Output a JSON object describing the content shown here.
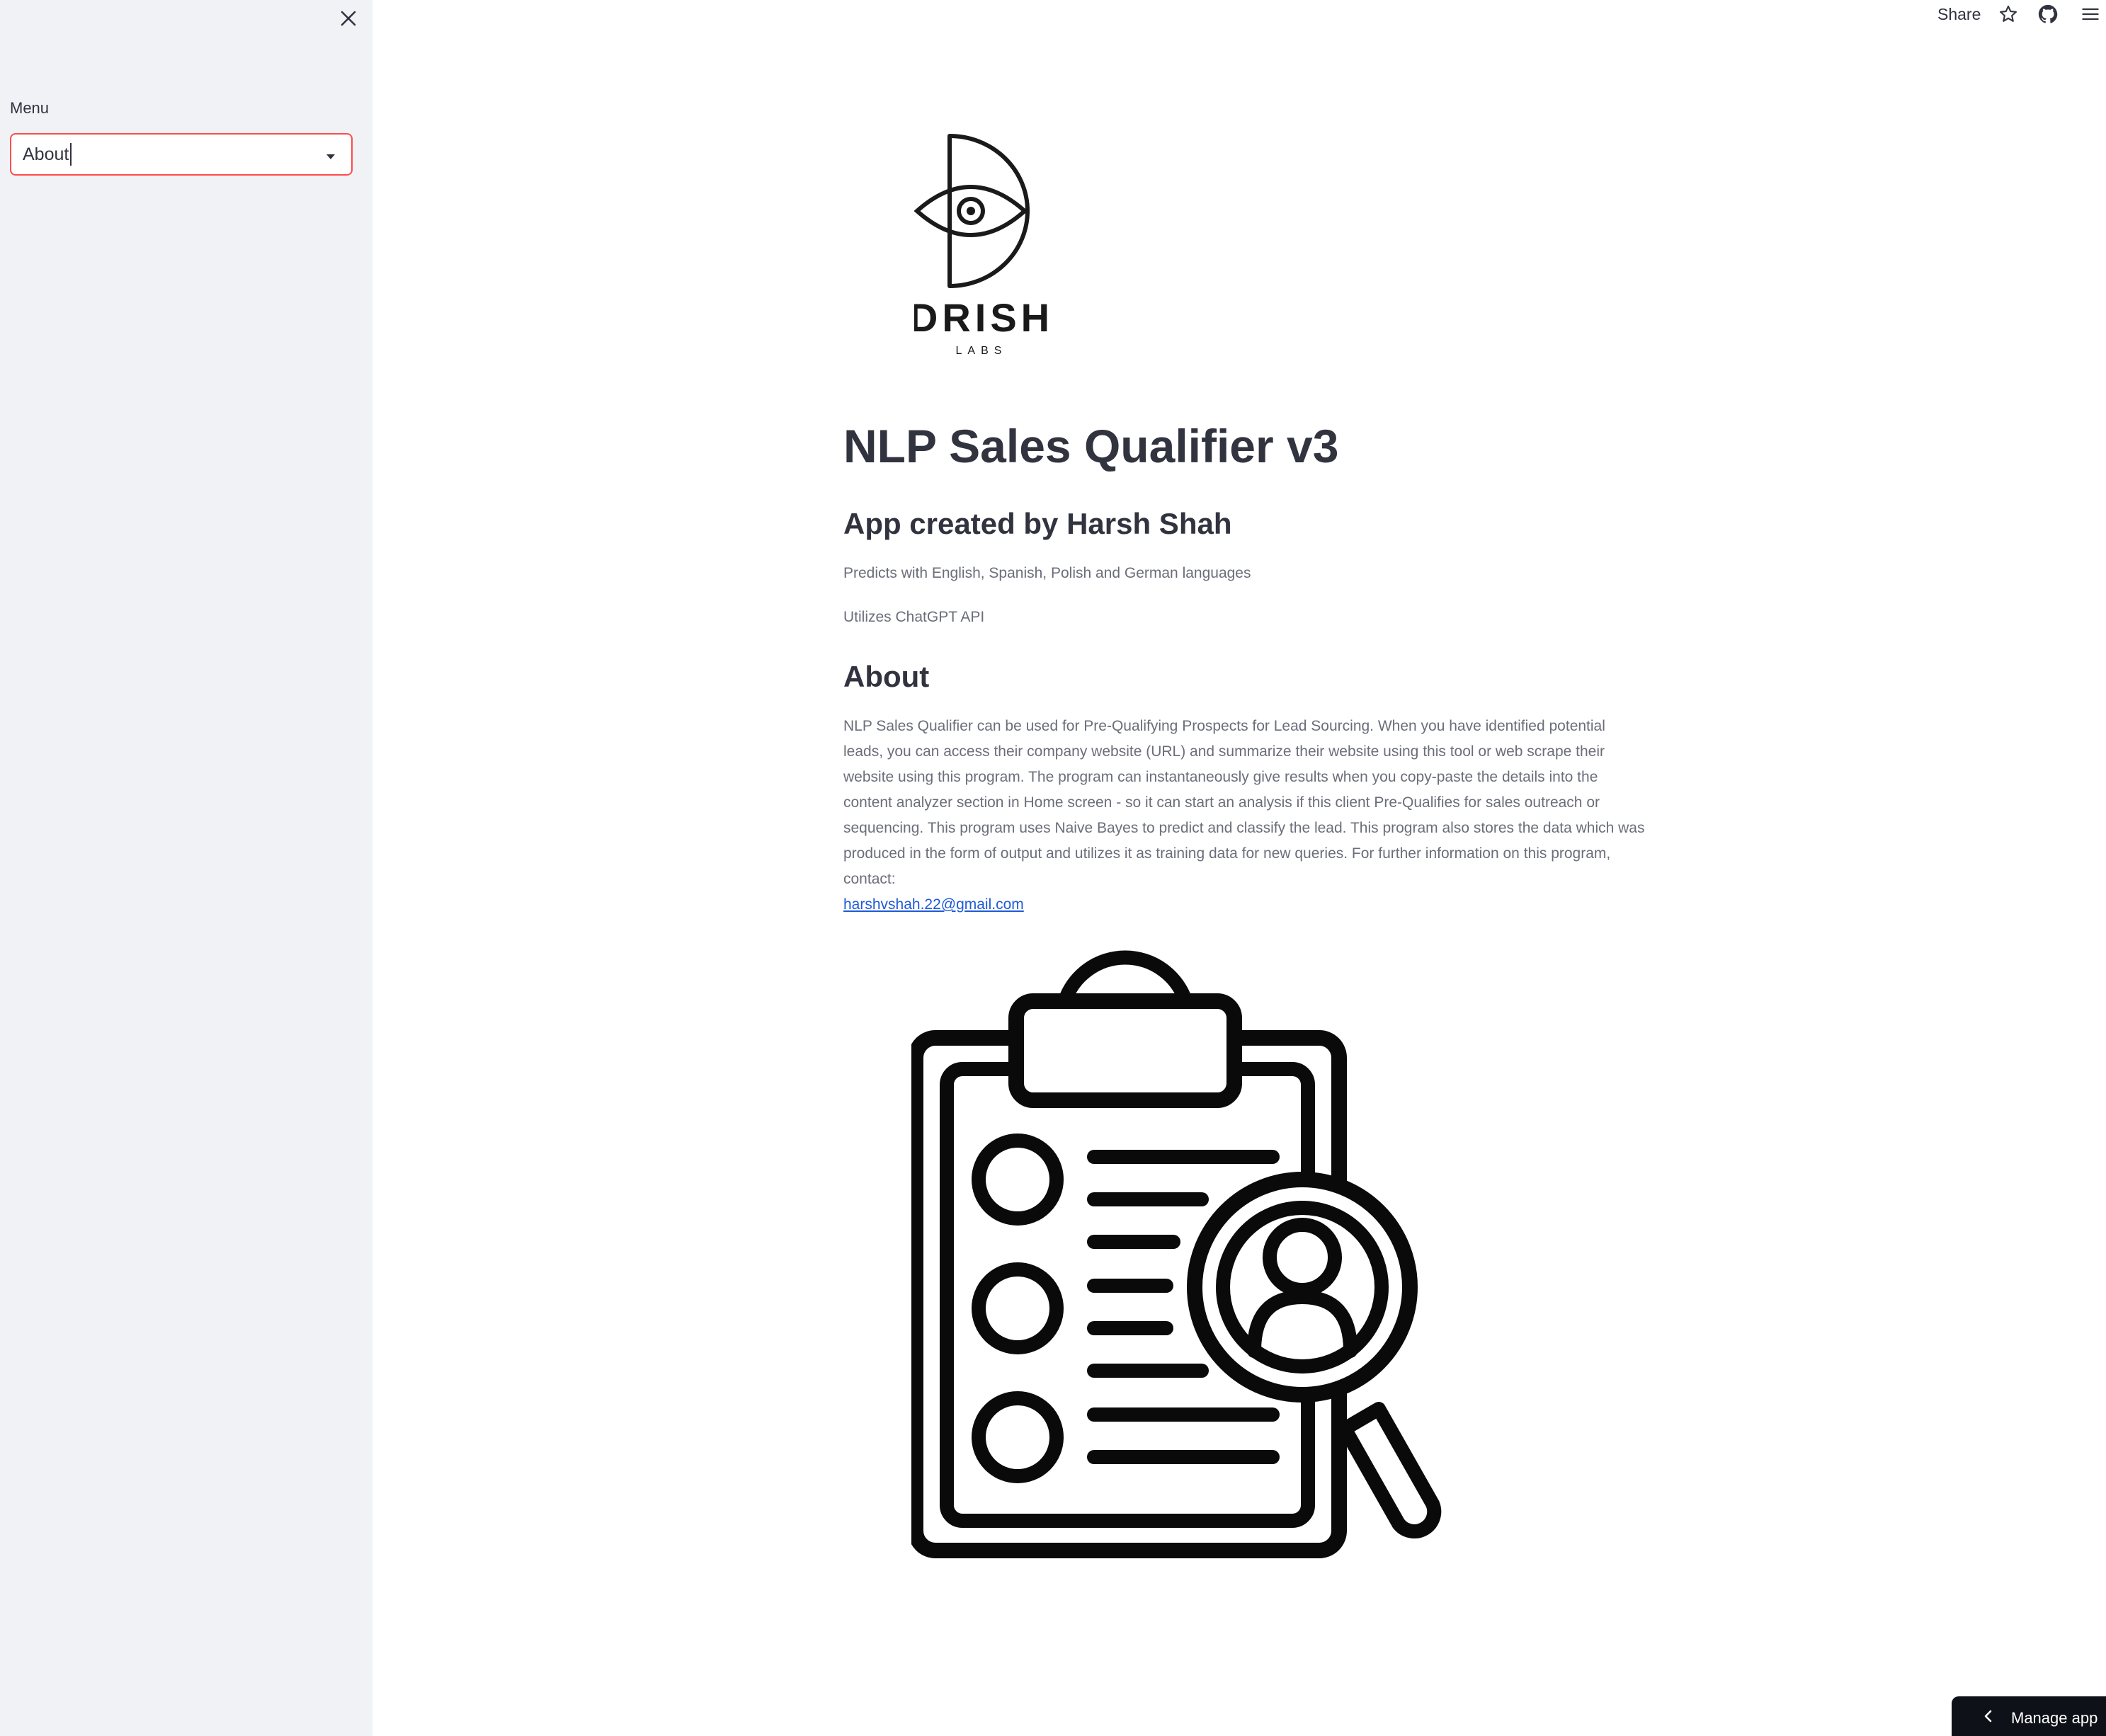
{
  "sidebar": {
    "menu_label": "Menu",
    "menu_selected": "About",
    "close_icon": "close-icon"
  },
  "toolbar": {
    "share_label": "Share",
    "icons": [
      "star-icon",
      "github-icon",
      "hamburger-menu-icon"
    ]
  },
  "main": {
    "logo": {
      "wordmark": "DRISH",
      "subtext": "LABS"
    },
    "title": "NLP Sales Qualifier v3",
    "subtitle": "App created by Harsh Shah",
    "captions": [
      "Predicts with English, Spanish, Polish and German languages",
      "Utilizes ChatGPT API"
    ],
    "about_heading": "About",
    "about_text": "NLP Sales Qualifier can be used for Pre-Qualifying Prospects for Lead Sourcing. When you have identified potential leads, you can access their company website (URL) and summarize their website using this tool or web scrape their website using this program. The program can instantaneously give results when you copy-paste the details into the content analyzer section in Home screen - so it can start an analysis if this client Pre-Qualifies for sales outreach or sequencing. This program uses Naive Bayes to predict and classify the lead. This program also stores the data which was produced in the form of output and utilizes it as training data for new queries. For further information on this program, contact:",
    "contact_email": "harshvshah.22@gmail.com",
    "illustration_icon": "clipboard-search-icon"
  },
  "manage_app": {
    "label": "Manage app"
  },
  "colors": {
    "sidebar_bg": "#f0f2f6",
    "accent": "#ff4b4b",
    "text": "#31333f",
    "muted_text": "#6b6e7a",
    "link": "#1f5bd8",
    "manage_app_bg": "#0e1117"
  }
}
